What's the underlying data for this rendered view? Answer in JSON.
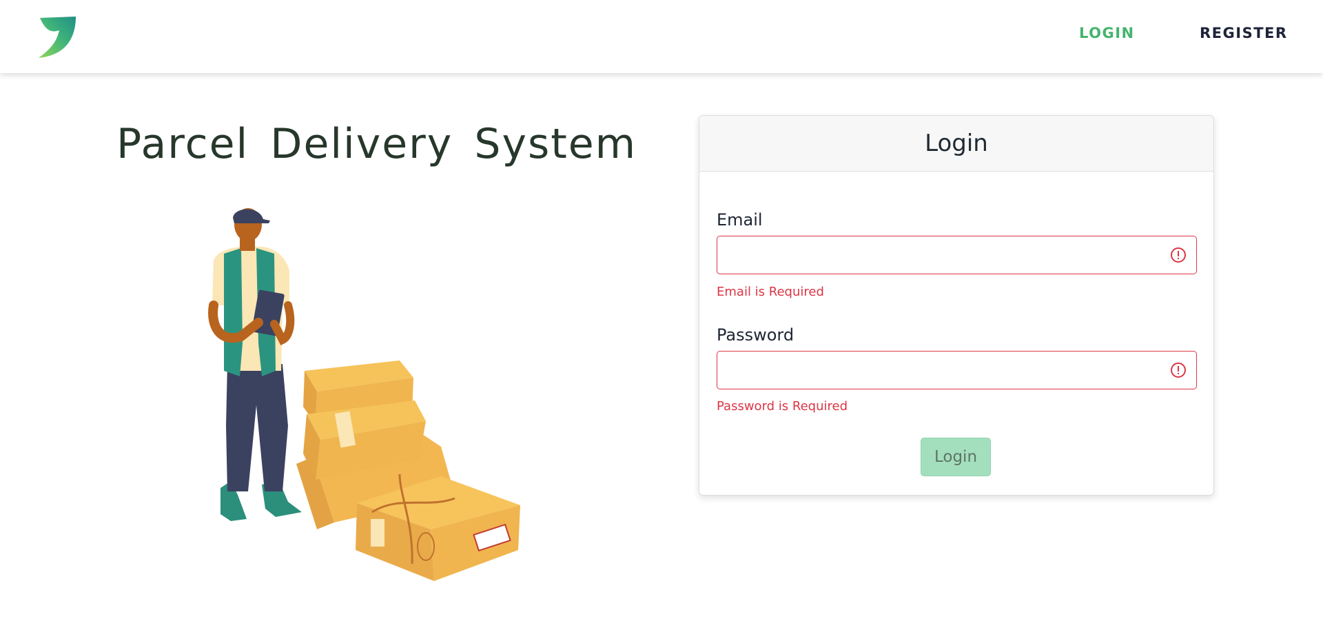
{
  "nav": {
    "login_label": "LOGIN",
    "register_label": "REGISTER",
    "active_color": "#45b46c",
    "text_color": "#1d2338"
  },
  "hero": {
    "title": "Parcel Delivery System"
  },
  "login_card": {
    "title": "Login",
    "email": {
      "label": "Email",
      "value": "",
      "error": "Email is Required"
    },
    "password": {
      "label": "Password",
      "value": "",
      "error": "Password is Required"
    },
    "submit_label": "Login",
    "error_color": "#dc3545",
    "button_color": "#a3dfbd"
  },
  "icons": {
    "logo": "leaf-logo-icon",
    "field_error": "alert-circle-icon"
  }
}
